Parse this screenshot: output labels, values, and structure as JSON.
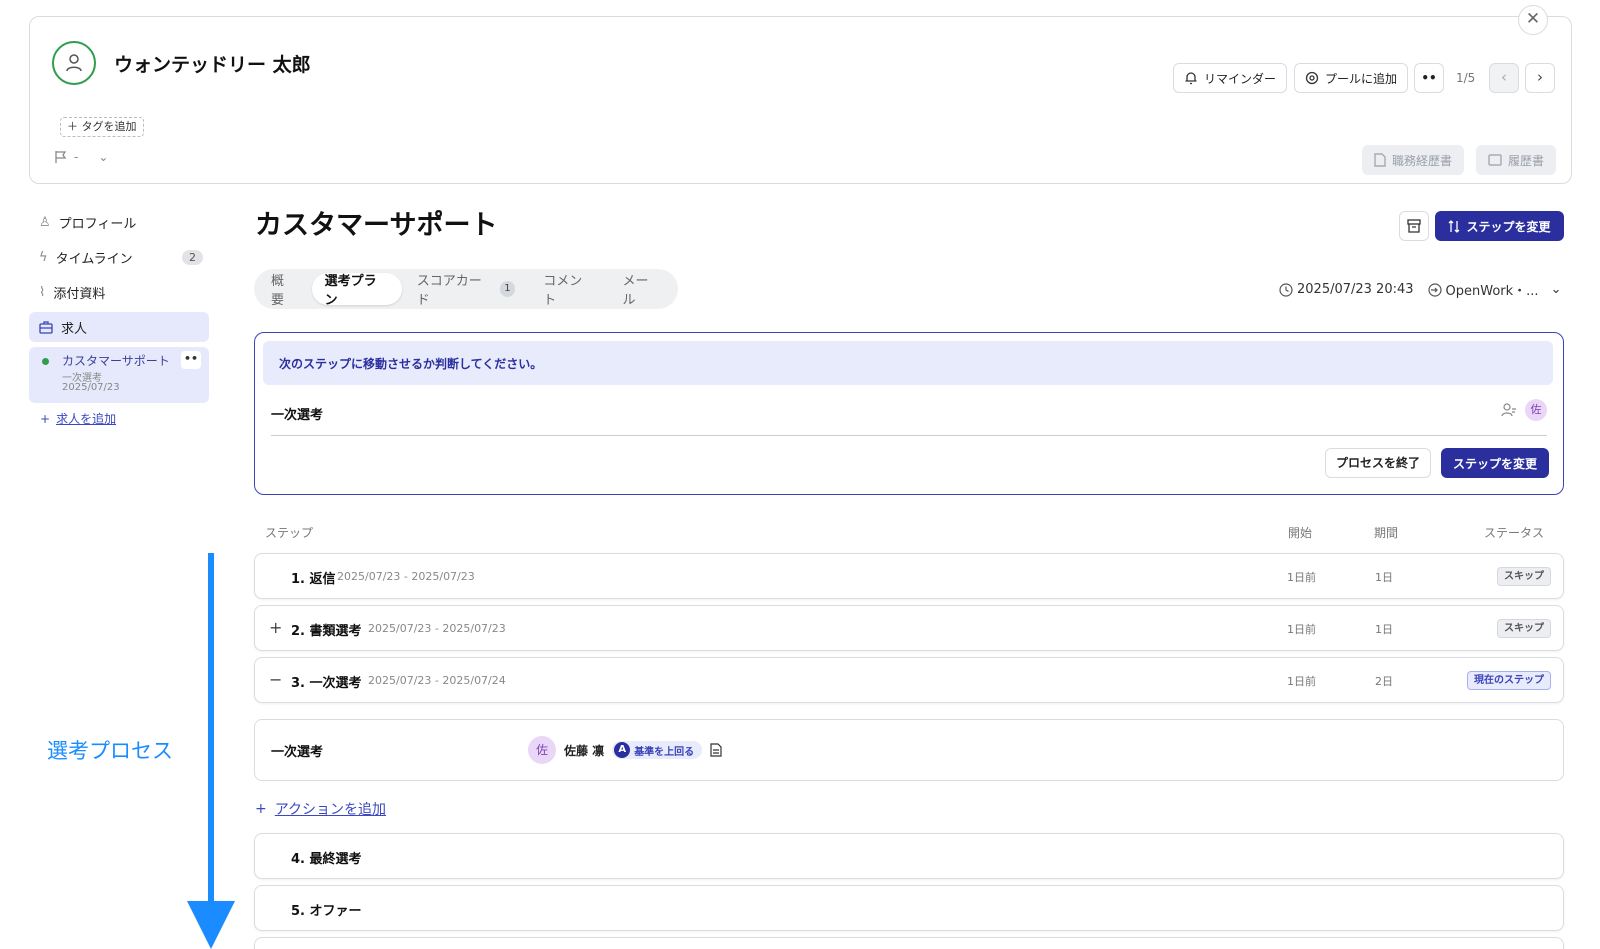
{
  "header": {
    "candidate_name": "ウォンテッドリー 太郎",
    "tag_add_label": "＋ タグを追加",
    "flag_value": "-",
    "reminder_label": "リマインダー",
    "pool_label": "プールに追加",
    "more_label": "••",
    "counter": "1/5",
    "prev_arrow": "‹",
    "next_arrow": "›",
    "close_glyph": "✕",
    "docs": [
      "職務経歴書",
      "履歴書"
    ]
  },
  "sidebar": {
    "items": [
      {
        "label": "プロフィール",
        "icon": "person-icon"
      },
      {
        "label": "タイムライン",
        "icon": "lightning-icon",
        "badge": "2"
      },
      {
        "label": "添付資料",
        "icon": "paperclip-icon"
      },
      {
        "label": "求人",
        "icon": "briefcase-icon"
      }
    ],
    "job": {
      "title": "カスタマーサポート",
      "step": "一次選考",
      "date": "2025/07/23",
      "more": "••"
    },
    "add_job_plus": "+",
    "add_job_label": "求人を追加"
  },
  "main": {
    "title": "カスタマーサポート",
    "change_step_label": "ステップを変更",
    "tabs": [
      {
        "label": "概要"
      },
      {
        "label": "選考プラン"
      },
      {
        "label": "スコアカード",
        "badge": "1"
      },
      {
        "label": "コメント"
      },
      {
        "label": "メール"
      }
    ],
    "datetime": "2025/07/23 20:43",
    "source": "OpenWork・...",
    "decision": {
      "banner": "次のステップに移動させるか判断してください。",
      "step": "一次選考",
      "assignee_initial": "佐",
      "end_label": "プロセスを終了",
      "change_label": "ステップを変更"
    },
    "table": {
      "headers": {
        "step": "ステップ",
        "start": "開始",
        "duration": "期間",
        "status": "ステータス"
      },
      "rows": [
        {
          "toggle": "",
          "name": "1. 返信",
          "dates": "2025/07/23 - 2025/07/23",
          "start": "1日前",
          "duration": "1日",
          "status": "スキップ",
          "kind": "skip"
        },
        {
          "toggle": "+",
          "name": "2. 書類選考",
          "dates": "2025/07/23 - 2025/07/23",
          "start": "1日前",
          "duration": "1日",
          "status": "スキップ",
          "kind": "skip"
        },
        {
          "toggle": "−",
          "name": "3. 一次選考",
          "dates": "2025/07/23 - 2025/07/24",
          "start": "1日前",
          "duration": "2日",
          "status": "現在のステップ",
          "kind": "current"
        },
        {
          "toggle": "",
          "name": "4. 最終選考",
          "dates": "",
          "start": "",
          "duration": "",
          "status": "",
          "kind": ""
        },
        {
          "toggle": "",
          "name": "5. オファー",
          "dates": "",
          "start": "",
          "duration": "",
          "status": "",
          "kind": ""
        }
      ]
    },
    "evaluation": {
      "name": "一次選考",
      "avatar_initial": "佐",
      "person": "佐藤 凛",
      "grade_letter": "A",
      "grade_label": "基準を上回る"
    },
    "add_action_plus": "+",
    "add_action_label": "アクションを追加"
  },
  "annotation": {
    "label": "選考プロセス",
    "color": "#1a8cff"
  },
  "colors": {
    "primary": "#2b2f9e",
    "accent_bg": "#e6e9fb",
    "status_green": "#2e9d4c"
  }
}
